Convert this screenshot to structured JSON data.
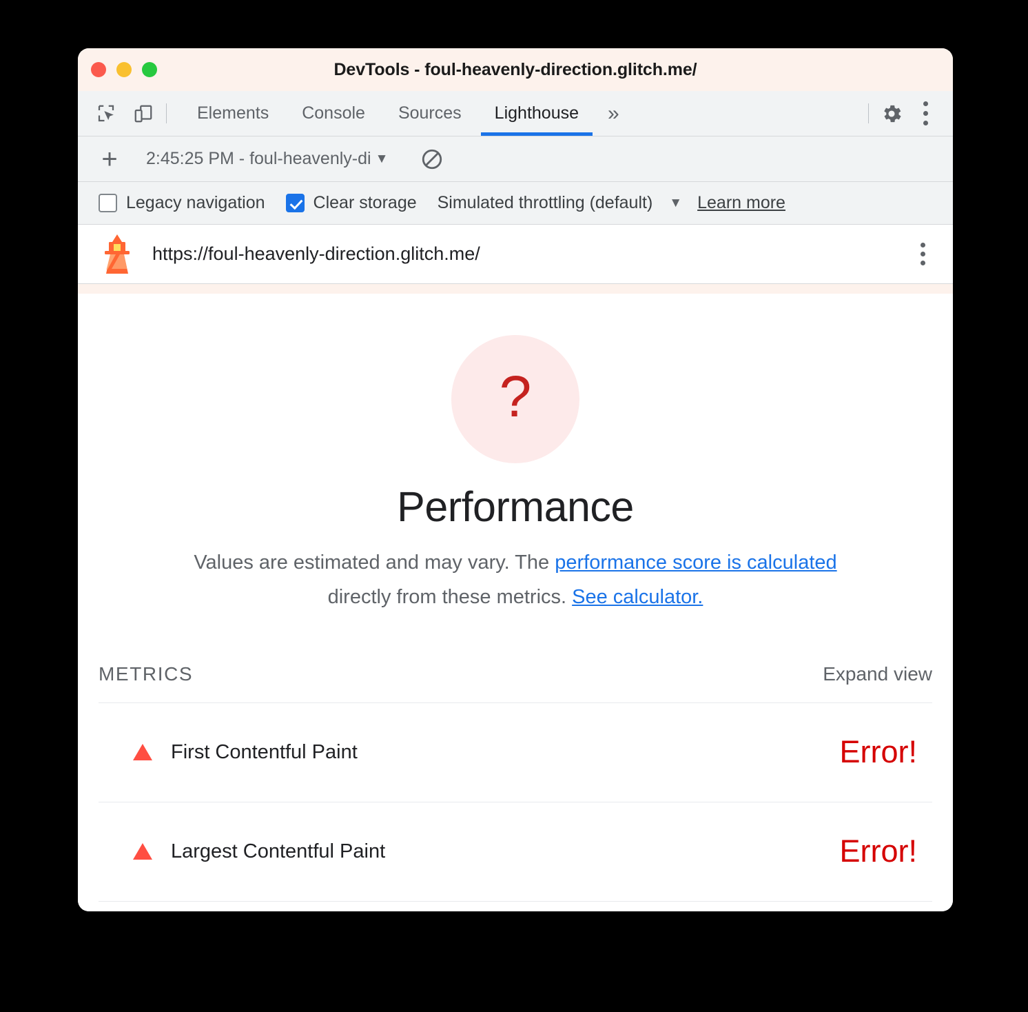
{
  "window": {
    "title": "DevTools - foul-heavenly-direction.glitch.me/",
    "traffic_lights": [
      "close",
      "minimize",
      "maximize"
    ]
  },
  "tabbar": {
    "inspect_icon": "inspect-element-icon",
    "device_icon": "device-toolbar-icon",
    "tabs": [
      {
        "label": "Elements",
        "active": false
      },
      {
        "label": "Console",
        "active": false
      },
      {
        "label": "Sources",
        "active": false
      },
      {
        "label": "Lighthouse",
        "active": true
      }
    ],
    "more_tabs_label": "»",
    "settings_icon": "gear-icon",
    "menu_icon": "kebab-menu-icon",
    "active_tab_color": "#1a73e8"
  },
  "lh_toolbar": {
    "new_run_label": "+",
    "run_selector_value": "2:45:25 PM - foul-heavenly-di",
    "run_selector_caret": "▼",
    "clear_icon": "clear-results-icon"
  },
  "settings_strip": {
    "legacy_navigation": {
      "label": "Legacy navigation",
      "checked": false
    },
    "clear_storage": {
      "label": "Clear storage",
      "checked": true
    },
    "throttling": {
      "label": "Simulated throttling (default)",
      "caret": "▼"
    },
    "learn_more": "Learn more"
  },
  "urlbar": {
    "logo_icon": "lighthouse-logo-icon",
    "url": "https://foul-heavenly-direction.glitch.me/",
    "menu_icon": "report-menu-kebab-icon"
  },
  "report": {
    "gauge": {
      "score_display": "?",
      "icon": "question-mark",
      "circle_color": "#fdeaea",
      "text_color": "#c5221f"
    },
    "category_title": "Performance",
    "description": {
      "part1": "Values are estimated and may vary. The ",
      "link1": "performance score is calculated",
      "part2": " directly from these metrics. ",
      "link2": "See calculator."
    },
    "metrics_header": "METRICS",
    "expand_view": "Expand view",
    "metrics": [
      {
        "name": "First Contentful Paint",
        "value": "Error!",
        "status": "fail",
        "icon": "triangle-fail-icon"
      },
      {
        "name": "Largest Contentful Paint",
        "value": "Error!",
        "status": "fail",
        "icon": "triangle-fail-icon"
      }
    ]
  },
  "colors": {
    "accent_blue": "#1a73e8",
    "error_red": "#d50000",
    "fail_triangle": "#ff4e42",
    "titlebar_bg": "#fdf2ec"
  }
}
